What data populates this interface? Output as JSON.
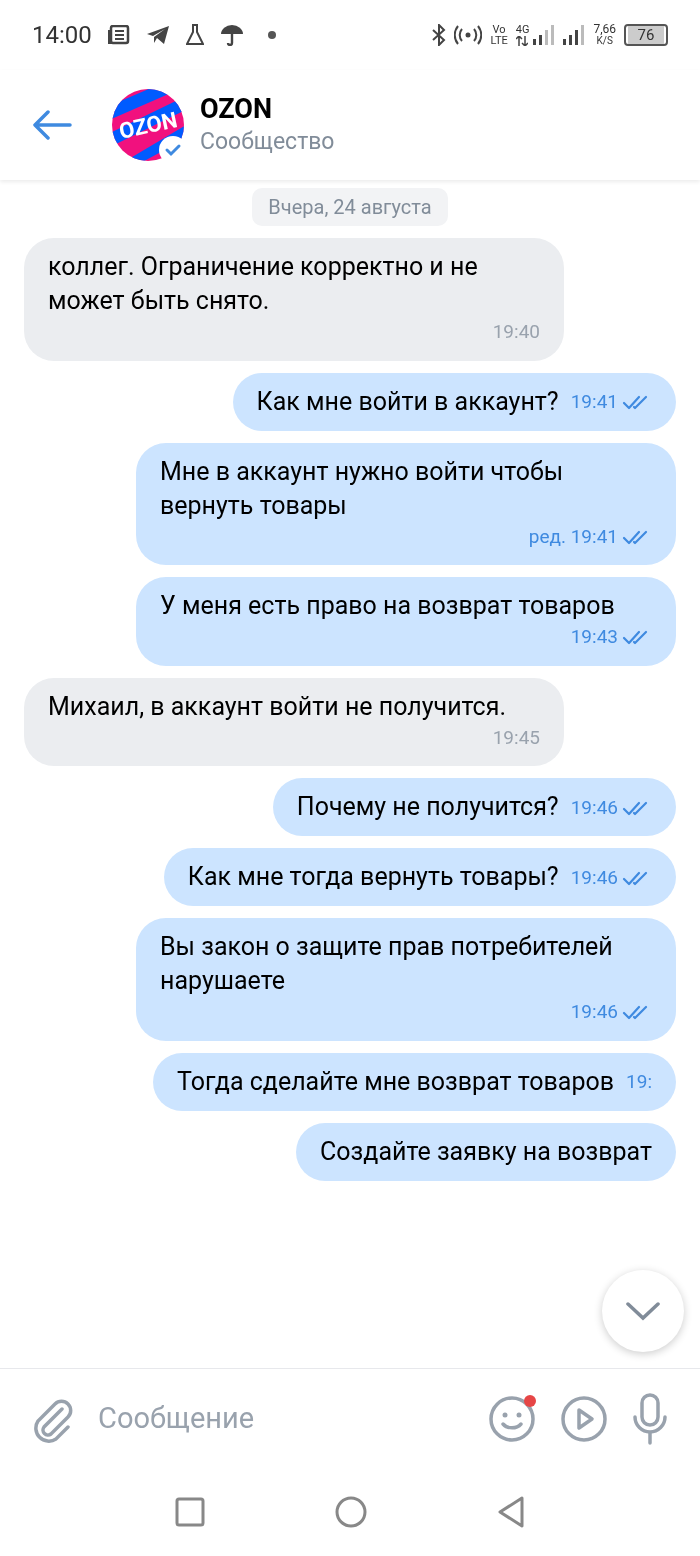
{
  "status_bar": {
    "time": "14:00",
    "volte_top": "Vo",
    "volte_bottom": "LTE",
    "network": "4G",
    "speed": "7,66",
    "speed_unit": "K/S",
    "battery": "76"
  },
  "header": {
    "title": "OZON",
    "subtitle": "Сообщество",
    "avatar_label": "OZON",
    "verified": true
  },
  "date_pill": "Вчера, 24 августа",
  "messages": [
    {
      "outgoing": false,
      "text": "коллег. Ограничение корректно и не может быть снято.",
      "time": "19:40"
    },
    {
      "outgoing": true,
      "text": "Как мне войти в аккаунт?",
      "time": "19:41",
      "read": true
    },
    {
      "outgoing": true,
      "text": "Мне в аккаунт нужно войти чтобы вернуть товары",
      "time": "ред. 19:41",
      "read": true
    },
    {
      "outgoing": true,
      "text": "У меня есть право на возврат товаров",
      "time": "19:43",
      "read": true
    },
    {
      "outgoing": false,
      "text": "Михаил, в аккаунт войти не получится.",
      "time": "19:45"
    },
    {
      "outgoing": true,
      "text": "Почему не получится?",
      "time": "19:46",
      "read": true
    },
    {
      "outgoing": true,
      "text": "Как мне тогда вернуть товары?",
      "time": "19:46",
      "read": true
    },
    {
      "outgoing": true,
      "text": "Вы закон о защите прав потребителей нарушаете",
      "time": "19:46",
      "read": true
    },
    {
      "outgoing": true,
      "text": "Тогда сделайте мне возврат товаров",
      "time": "19:"
    },
    {
      "outgoing": true,
      "text": "Создайте заявку на возврат"
    }
  ],
  "composer": {
    "placeholder": "Сообщение",
    "emoji_notification": true
  }
}
